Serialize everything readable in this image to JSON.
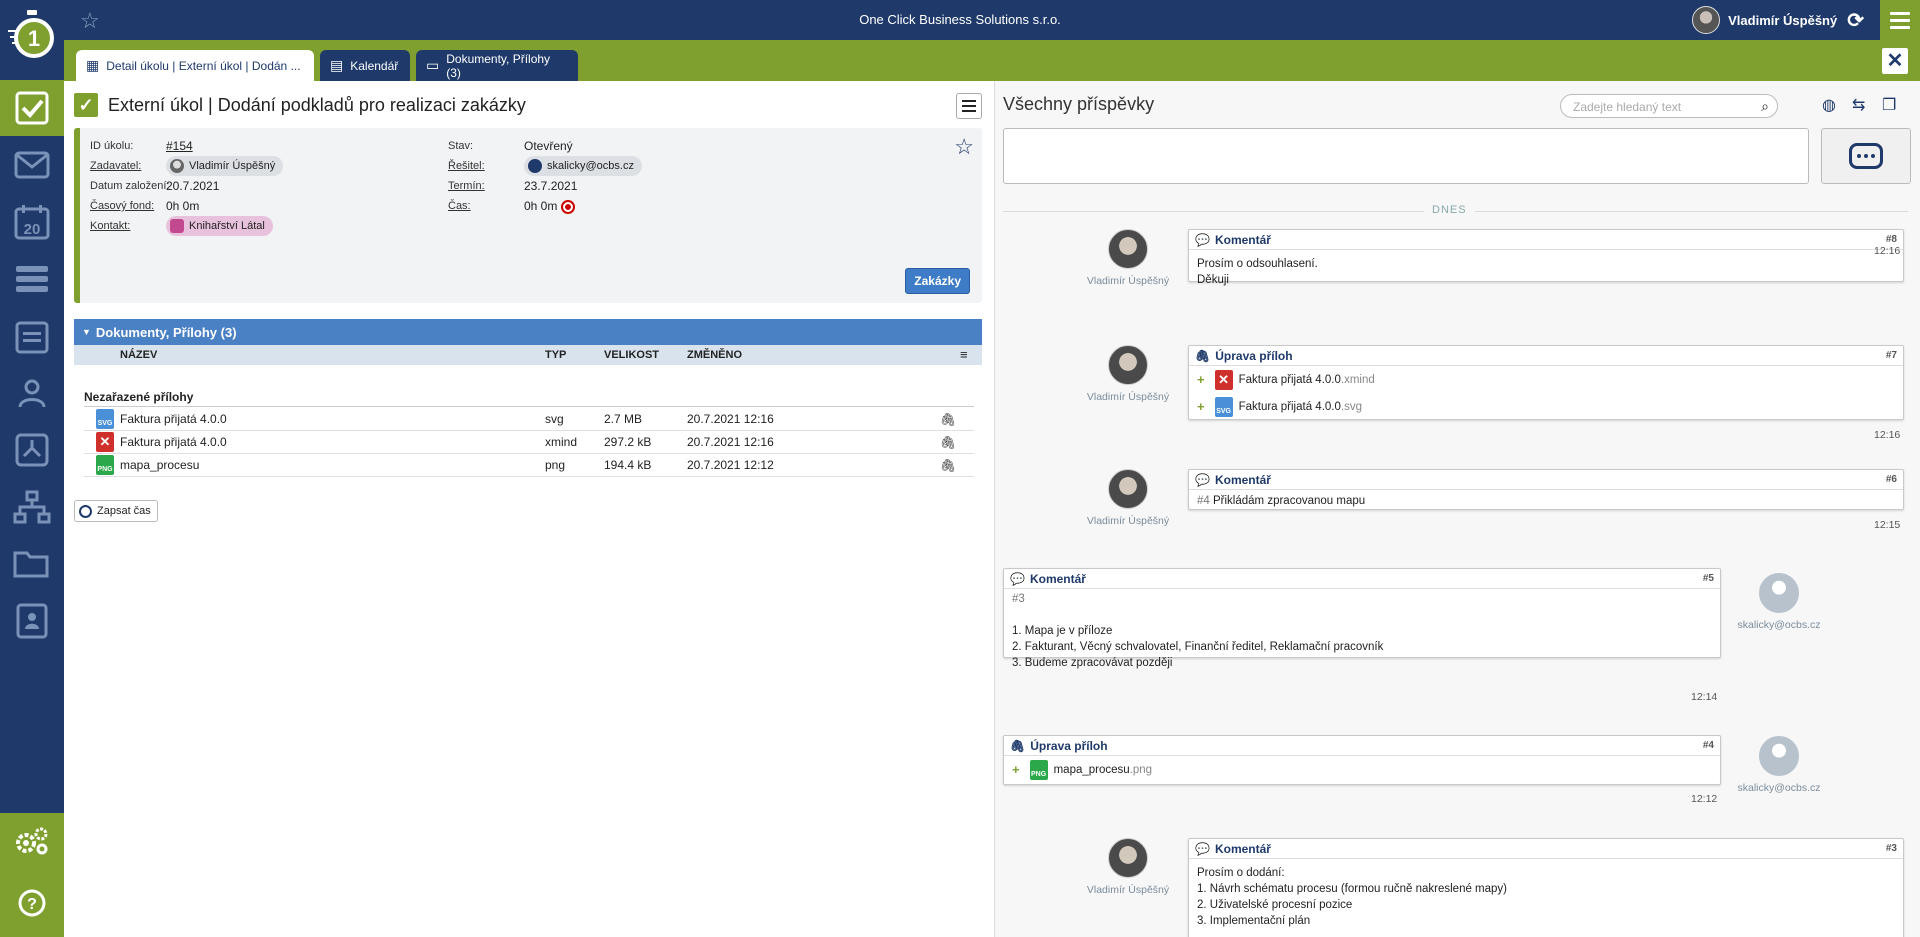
{
  "header": {
    "company": "One Click Business Solutions s.r.o.",
    "user_name": "Vladimír Úspěšný"
  },
  "tabs": [
    {
      "label": "Detail úkolu | Externí úkol | Dodán ...",
      "icon": "dashboard-icon"
    },
    {
      "label": "Kalendář",
      "icon": "calendar-icon"
    },
    {
      "label": "Dokumenty, Přílohy (3)",
      "icon": "folder-icon"
    }
  ],
  "sidebar": {
    "items": [
      "tasks-icon",
      "mail-icon",
      "calendar-icon",
      "list-icon",
      "agenda-icon",
      "users-icon",
      "process-icon",
      "org-chart-icon",
      "folder-icon",
      "contacts-icon"
    ],
    "calendar_day": "20",
    "bottom": [
      "settings-icon",
      "help-icon"
    ]
  },
  "task": {
    "title": "Externí úkol | Dodání podkladů pro realizaci zakázky",
    "labels": {
      "id": "ID úkolu:",
      "requester": "Zadavatel:",
      "created": "Datum založení:",
      "time_fund": "Časový fond:",
      "contact": "Kontakt:",
      "state": "Stav:",
      "solver": "Řešitel:",
      "deadline": "Termín:",
      "time": "Čas:"
    },
    "values": {
      "id": "#154",
      "requester": "Vladimír Úspěšný",
      "created": "20.7.2021",
      "time_fund": "0h 0m",
      "contact": "Knihařství Látal",
      "state": "Otevřený",
      "solver": "skalicky@ocbs.cz",
      "deadline": "23.7.2021",
      "time": "0h 0m"
    },
    "orders_button": "Zakázky"
  },
  "documents": {
    "header": "Dokumenty, Přílohy (3)",
    "columns": {
      "name": "NÁZEV",
      "type": "TYP",
      "size": "VELIKOST",
      "changed": "ZMĚNĚNO"
    },
    "group": "Nezařazené přílohy",
    "rows": [
      {
        "name": "Faktura přijatá 4.0.0",
        "type": "svg",
        "size": "2.7 MB",
        "changed": "20.7.2021 12:16"
      },
      {
        "name": "Faktura přijatá 4.0.0",
        "type": "xmind",
        "size": "297.2 kB",
        "changed": "20.7.2021 12:16"
      },
      {
        "name": "mapa_procesu",
        "type": "png",
        "size": "194.4 kB",
        "changed": "20.7.2021 12:12"
      }
    ],
    "log_time_button": "Zapsat čas"
  },
  "feed": {
    "title": "Všechny příspěvky",
    "search_placeholder": "Zadejte hledaný text",
    "day_separator": "DNES",
    "posts": [
      {
        "type": "Komentář",
        "num": "#8",
        "author": "Vladimír Úspěšný",
        "time": "12:16",
        "lines": [
          "Prosím o odsouhlasení.",
          "Děkuji"
        ]
      },
      {
        "type": "Úprava příloh",
        "num": "#7",
        "author": "Vladimír Úspěšný",
        "time": "12:16",
        "attachments": [
          {
            "name": "Faktura přijatá 4.0.0",
            "ext": ".xmind"
          },
          {
            "name": "Faktura přijatá 4.0.0",
            "ext": ".svg"
          }
        ]
      },
      {
        "type": "Komentář",
        "num": "#6",
        "author": "Vladimír Úspěšný",
        "time": "12:15",
        "ref": "#4",
        "text": "Přikládám zpracovanou mapu"
      },
      {
        "type": "Komentář",
        "num": "#5",
        "author": "skalicky@ocbs.cz",
        "time": "12:14",
        "ref": "#3",
        "lines": [
          "1. Mapa je v příloze",
          "2. Fakturant, Věcný schvalovatel, Finanční ředitel, Reklamační pracovník",
          "3. Budeme zpracovávat později"
        ]
      },
      {
        "type": "Úprava příloh",
        "num": "#4",
        "author": "skalicky@ocbs.cz",
        "time": "12:12",
        "attachments": [
          {
            "name": "mapa_procesu",
            "ext": ".png"
          }
        ]
      },
      {
        "type": "Komentář",
        "num": "#3",
        "author": "Vladimír Úspěšný",
        "lines": [
          "Prosím o dodání:",
          "1. Návrh schématu procesu (formou ručně nakreslené mapy)",
          "2. Uživatelské procesní pozice",
          "3. Implementační plán"
        ]
      }
    ]
  },
  "colors": {
    "navy": "#1f3a6a",
    "green": "#7fa02f",
    "blue": "#4a80c4"
  }
}
